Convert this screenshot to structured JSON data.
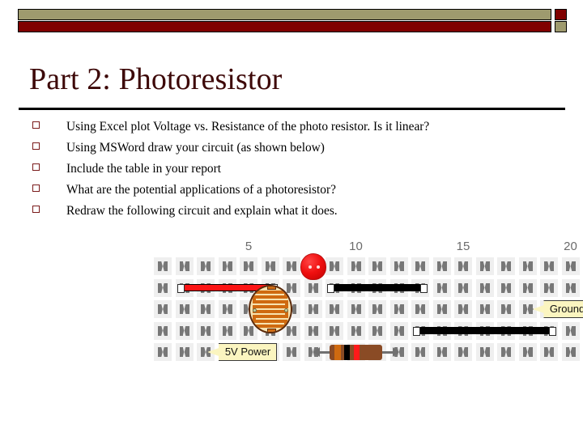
{
  "slide": {
    "title": "Part 2: Photoresistor",
    "banner": {
      "top_bar_color": "#9e9a6e",
      "bottom_bar_color": "#800000",
      "top_square_color": "#800000",
      "bottom_square_color": "#9e9a6e"
    },
    "title_color": "#3d0808",
    "bullets": [
      {
        "marker": "hollow-square",
        "text": "Using Excel plot Voltage vs. Resistance of the photo resistor. Is it linear?"
      },
      {
        "marker": "hollow-square",
        "text": "Using MSWord draw your circuit (as shown below)"
      },
      {
        "marker": "hollow-square",
        "text": "Include the table in your report"
      },
      {
        "marker": "hollow-square",
        "text": "What are the potential applications of a photoresistor?"
      },
      {
        "marker": "hollow-square",
        "text": "Redraw the following circuit and explain what it does."
      }
    ]
  },
  "breadboard": {
    "columns": 20,
    "rows": 5,
    "column_labels": [
      {
        "label": "5",
        "column": 5
      },
      {
        "label": "10",
        "column": 10
      },
      {
        "label": "15",
        "column": 15
      },
      {
        "label": "20",
        "column": 20
      }
    ],
    "label_color": "#6b6b6b",
    "components": [
      {
        "name": "led",
        "type": "led",
        "color": "#f01010",
        "row": 1,
        "column": 8
      },
      {
        "name": "red-wire",
        "type": "wire",
        "color": "#fc1414",
        "row": 2,
        "from_column": 2,
        "to_column": 6
      },
      {
        "name": "black-wire-top",
        "type": "wire",
        "color": "#000000",
        "row": 2,
        "from_column": 9,
        "to_column": 13
      },
      {
        "name": "photoresistor",
        "type": "photoresistor",
        "body_color": "#f7e3b0",
        "track_color": "#cf6a10",
        "row": 3,
        "column": 6
      },
      {
        "name": "black-wire-bottom",
        "type": "wire",
        "color": "#000000",
        "row": 4,
        "from_column": 13,
        "to_column": 19
      },
      {
        "name": "resistor",
        "type": "resistor",
        "body_color": "#8a4b25",
        "bands": [
          "#cf6a10",
          "#000000",
          "#ff1a1a"
        ],
        "row": 5,
        "from_column": 8,
        "to_column": 12
      }
    ],
    "callouts": [
      {
        "name": "ground-callout",
        "text": "Ground",
        "row": 3,
        "column": 18,
        "fill": "#fbf5c0"
      },
      {
        "name": "power-callout",
        "text": "5V Power",
        "row": 5,
        "column": 3,
        "fill": "#fbf5c0"
      }
    ]
  }
}
